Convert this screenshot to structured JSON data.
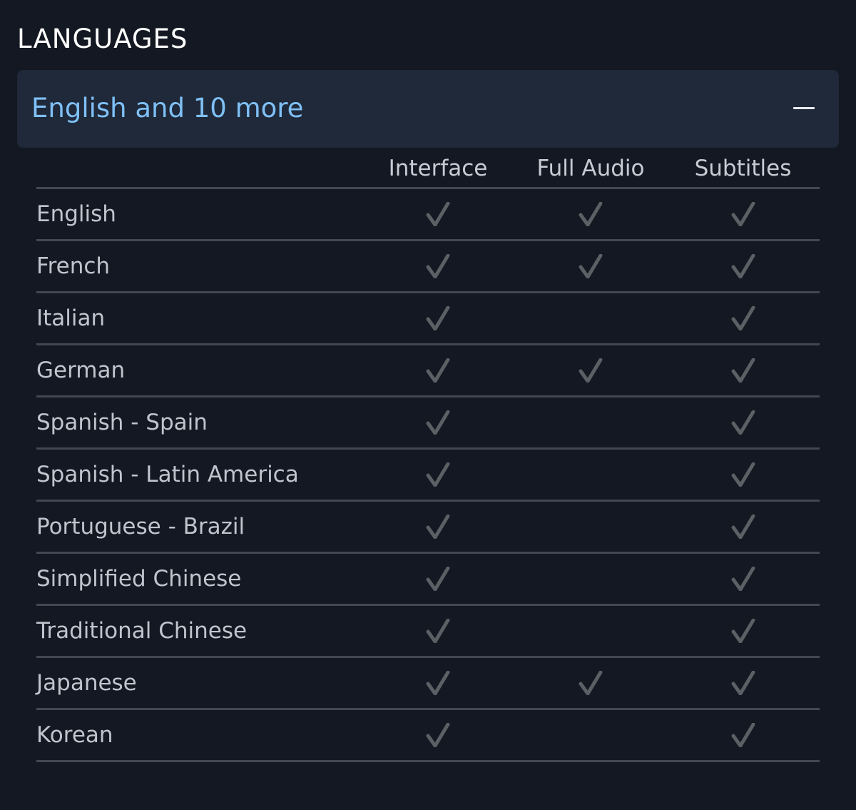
{
  "section": {
    "title": "LANGUAGES"
  },
  "accordion": {
    "summary": "English and 10 more",
    "expanded": true
  },
  "table": {
    "headers": [
      "Interface",
      "Full Audio",
      "Subtitles"
    ],
    "rows": [
      {
        "language": "English",
        "interface": true,
        "full_audio": true,
        "subtitles": true
      },
      {
        "language": "French",
        "interface": true,
        "full_audio": true,
        "subtitles": true
      },
      {
        "language": "Italian",
        "interface": true,
        "full_audio": false,
        "subtitles": true
      },
      {
        "language": "German",
        "interface": true,
        "full_audio": true,
        "subtitles": true
      },
      {
        "language": "Spanish - Spain",
        "interface": true,
        "full_audio": false,
        "subtitles": true
      },
      {
        "language": "Spanish - Latin America",
        "interface": true,
        "full_audio": false,
        "subtitles": true
      },
      {
        "language": "Portuguese - Brazil",
        "interface": true,
        "full_audio": false,
        "subtitles": true
      },
      {
        "language": "Simplified Chinese",
        "interface": true,
        "full_audio": false,
        "subtitles": true
      },
      {
        "language": "Traditional Chinese",
        "interface": true,
        "full_audio": false,
        "subtitles": true
      },
      {
        "language": "Japanese",
        "interface": true,
        "full_audio": true,
        "subtitles": true
      },
      {
        "language": "Korean",
        "interface": true,
        "full_audio": false,
        "subtitles": true
      }
    ]
  },
  "colors": {
    "background": "#131822",
    "accordion_bg": "#1f2939",
    "accent_text": "#7fc0f6",
    "check": "#5c5f64",
    "divider": "#424852"
  },
  "icons": {
    "check": "check-icon",
    "collapse": "minus-icon"
  }
}
